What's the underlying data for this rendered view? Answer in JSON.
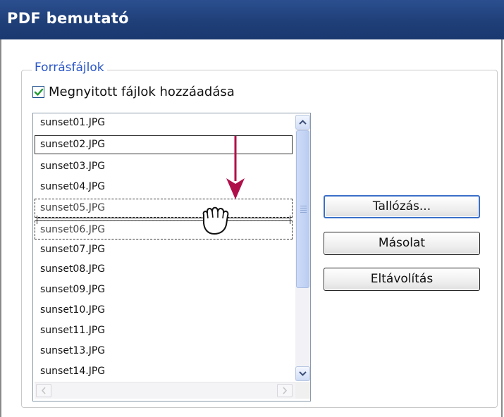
{
  "window": {
    "title": "PDF bemutató"
  },
  "group": {
    "legend": "Forrásfájlok"
  },
  "checkbox": {
    "label": "Megnyitott fájlok hozzáadása",
    "checked": true
  },
  "file_list": {
    "items": [
      "sunset01.JPG",
      "sunset02.JPG",
      "sunset03.JPG",
      "sunset04.JPG",
      "sunset05.JPG",
      "sunset06.JPG",
      "sunset07.JPG",
      "sunset08.JPG",
      "sunset09.JPG",
      "sunset10.JPG",
      "sunset11.JPG",
      "sunset13.JPG",
      "sunset14.JPG"
    ]
  },
  "buttons": {
    "browse": "Tallózás...",
    "duplicate": "Másolat",
    "remove": "Eltávolítás"
  },
  "colors": {
    "titlebar": "#1f3f78",
    "legend_text": "#2a56c6",
    "drag_arrow": "#b0104a",
    "default_button_border": "#3a6fc9"
  },
  "icons": {
    "arrow": "drag-arrow-icon",
    "cursor": "hand-grab-icon"
  }
}
